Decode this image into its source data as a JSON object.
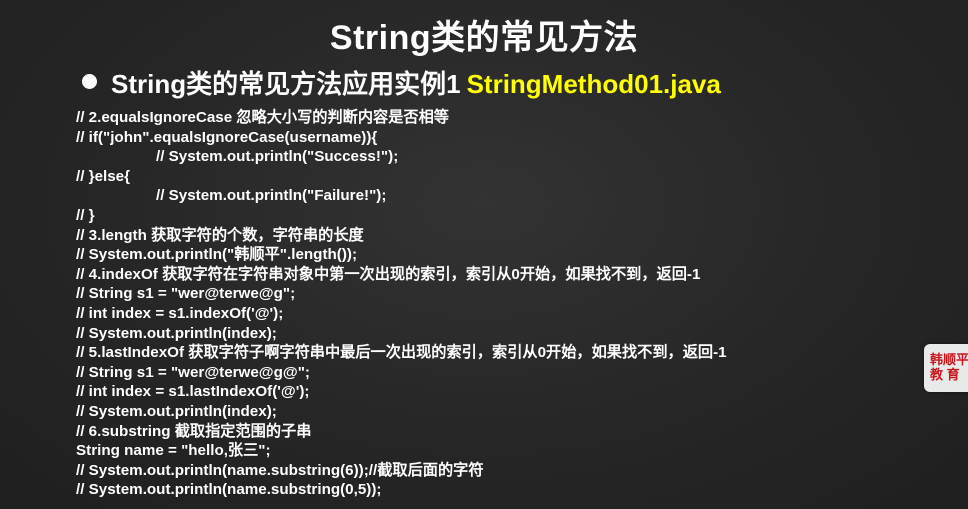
{
  "slide": {
    "title": "String类的常见方法",
    "subtitle": "String类的常见方法应用实例1",
    "file_name": "StringMethod01.java"
  },
  "code_lines": [
    "// 2.equalsIgnoreCase 忽略大小写的判断内容是否相等",
    "// if(\"john\".equalsIgnoreCase(username)){",
    "// System.out.println(\"Success!\");",
    "// }else{",
    "// System.out.println(\"Failure!\");",
    "// }",
    "// 3.length 获取字符的个数，字符串的长度",
    "// System.out.println(\"韩顺平\".length());",
    "// 4.indexOf 获取字符在字符串对象中第一次出现的索引，索引从0开始，如果找不到，返回-1",
    "// String s1 = \"wer@terwe@g\";",
    "// int index = s1.indexOf('@');",
    "// System.out.println(index);",
    "// 5.lastIndexOf 获取字符子啊字符串中最后一次出现的索引，索引从0开始，如果找不到，返回-1",
    "// String s1 = \"wer@terwe@g@\";",
    "// int index = s1.lastIndexOf('@');",
    "// System.out.println(index);",
    "// 6.substring 截取指定范围的子串",
    "String name = \"hello,张三\";",
    "// System.out.println(name.substring(6));//截取后面的字符",
    "// System.out.println(name.substring(0,5));"
  ],
  "logo": {
    "line1": "韩顺平",
    "line2": "教  育"
  },
  "colors": {
    "background": "#262626",
    "text": "#ffffff",
    "file_name": "#ffff00",
    "logo_text": "#c8161d"
  }
}
